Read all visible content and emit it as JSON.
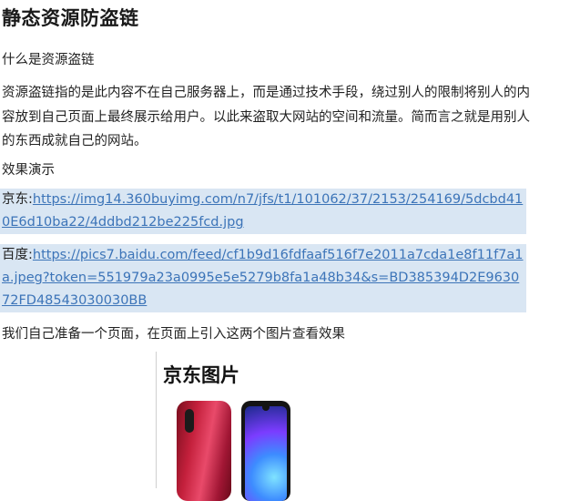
{
  "title": "静态资源防盗链",
  "subtitle": "什么是资源盗链",
  "paragraph": "资源盗链指的是此内容不在自己服务器上，而是通过技术手段，绕过别人的限制将别人的内容放到自己页面上最终展示给用户。以此来盗取大网站的空间和流量。简而言之就是用别人的东西成就自己的网站。",
  "demo_heading": "效果演示",
  "links": [
    {
      "label": "京东:",
      "url": "https://img14.360buyimg.com/n7/jfs/t1/101062/37/2153/254169/5dcbd410E6d10ba22/4ddbd212be225fcd.jpg"
    },
    {
      "label": "百度:",
      "url": "https://pics7.baidu.com/feed/cf1b9d16fdfaaf516f7e2011a7cda1e8f11f7a1a.jpeg?token=551979a23a0995e5e5279b8fa1a48b34&s=BD385394D2E963072FD48543030030BB"
    }
  ],
  "closing": "我们自己准备一个页面，在页面上引入这两个图片查看效果",
  "figure": {
    "title": "京东图片"
  }
}
